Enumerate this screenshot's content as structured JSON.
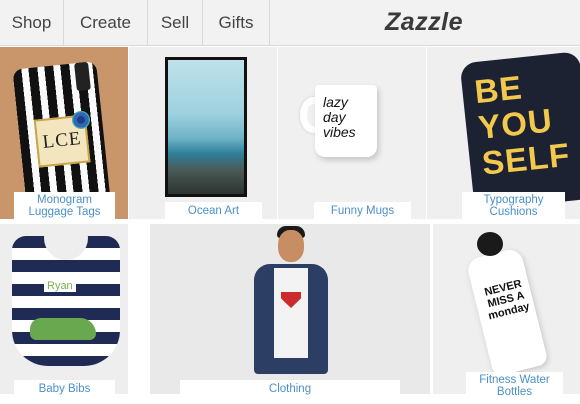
{
  "nav": {
    "items": [
      {
        "label": "Shop"
      },
      {
        "label": "Create"
      },
      {
        "label": "Sell"
      },
      {
        "label": "Gifts"
      }
    ],
    "logo": "Zazzle"
  },
  "tiles": [
    {
      "label": "Monogram\nLuggage Tags",
      "art_text": "LCE"
    },
    {
      "label": "Ocean Art"
    },
    {
      "label": "Funny Mugs",
      "art_text": "lazy\nday\nvibes"
    },
    {
      "label": "Typography\nCushions",
      "art_text": "BE\nYOU\nSELF"
    },
    {
      "label": "Baby Bibs",
      "art_text": "Ryan"
    },
    {
      "label": "Clothing"
    },
    {
      "label": "Fitness Water\nBottles",
      "art_text": "NEVER\nMISS A\nmonday"
    }
  ],
  "colors": {
    "label_text": "#4a90c8",
    "nav_bg": "#f2f2f2"
  }
}
